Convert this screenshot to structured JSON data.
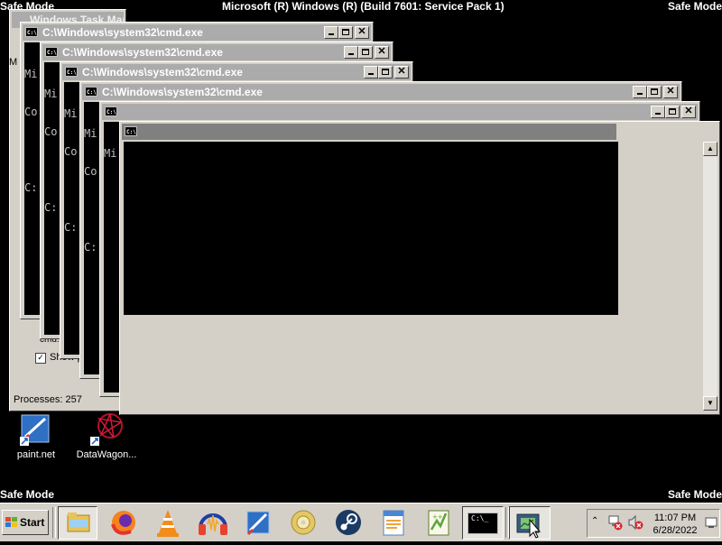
{
  "safe_mode": {
    "top_left": "Safe Mode",
    "top_center": "Microsoft (R) Windows (R) (Build 7601: Service Pack 1)",
    "top_right": "Safe Mode",
    "bottom_left": "Safe Mode",
    "bottom_right": "Safe Mode"
  },
  "task_manager": {
    "title": "Windows Task Manager",
    "checkbox_partial": "Show p",
    "status_processes": "Processes: 257",
    "side_text_1": "M",
    "row_text": "cmd."
  },
  "cmd_windows": [
    {
      "title": "C:\\Windows\\system32\\cmd.exe",
      "lines": [
        "Mi",
        "Co",
        "",
        "C:"
      ]
    },
    {
      "title": "C:\\Windows\\system32\\cmd.exe",
      "lines": [
        "Mi",
        "Co",
        "",
        "C:"
      ]
    },
    {
      "title": "C:\\Windows\\system32\\cmd.exe",
      "lines": [
        "Mi",
        "Co",
        "",
        "C:"
      ]
    },
    {
      "title": "C:\\Windows\\system32\\cmd.exe",
      "lines": [
        "Mi",
        "Co",
        "",
        "C:"
      ]
    },
    {
      "title": "",
      "lines": [
        "Mi"
      ]
    },
    {
      "title": "",
      "lines": []
    }
  ],
  "cmd_icon_text": "C:\\_",
  "desktop_icons": [
    {
      "label": "paint.net",
      "icon": "paint-net-icon"
    },
    {
      "label": "DataWagon...",
      "icon": "datawagon-icon"
    }
  ],
  "taskbar": {
    "start_label": "Start",
    "pinned": [
      {
        "name": "explorer",
        "icon": "folder-icon"
      },
      {
        "name": "firefox",
        "icon": "firefox-icon"
      },
      {
        "name": "vlc",
        "icon": "vlc-icon"
      },
      {
        "name": "audacity",
        "icon": "audacity-icon"
      },
      {
        "name": "paint.net",
        "icon": "paint-net-icon"
      },
      {
        "name": "dvd",
        "icon": "disc-icon"
      },
      {
        "name": "steam",
        "icon": "steam-icon"
      },
      {
        "name": "wordpad",
        "icon": "wordpad-icon"
      },
      {
        "name": "notepad++",
        "icon": "notepad-plus-icon"
      },
      {
        "name": "cmd",
        "icon": "cmd-icon"
      },
      {
        "name": "task-manager",
        "icon": "task-manager-icon"
      }
    ],
    "cmd_button_text": "C:\\_",
    "clock_time": "11:07 PM",
    "clock_date": "6/28/2022"
  },
  "colors": {
    "desktop": "#000000",
    "chrome": "#d4d0c8",
    "title_inactive": "#ababab"
  }
}
